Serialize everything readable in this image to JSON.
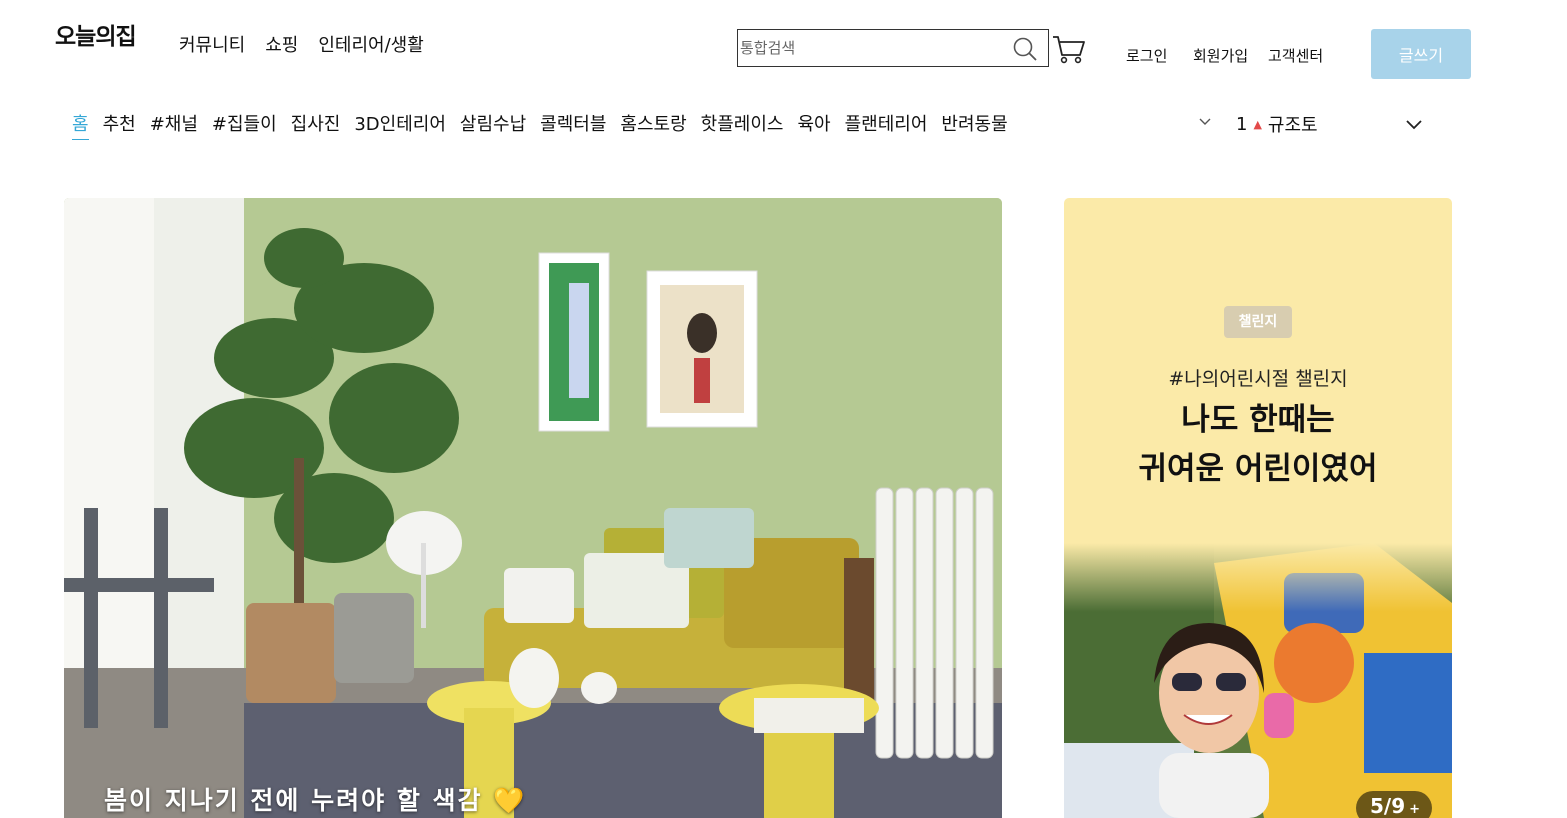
{
  "header": {
    "logo": "오늘의집",
    "nav": [
      "커뮤니티",
      "쇼핑",
      "인테리어/생활"
    ],
    "search_placeholder": "통합검색",
    "login": "로그인",
    "signup": "회원가입",
    "support": "고객센터",
    "write_button": "글쓰기",
    "write_button_color": "#a8d3ea"
  },
  "category_tabs": {
    "items": [
      "홈",
      "추천",
      "#채널",
      "#집들이",
      "집사진",
      "3D인테리어",
      "살림수납",
      "콜렉터블",
      "홈스토랑",
      "핫플레이스",
      "육아",
      "플랜테리어",
      "반려동물"
    ],
    "active_index": 0,
    "active_color": "#35a7d6"
  },
  "trending": {
    "rank": "1",
    "direction_symbol": "▲",
    "keyword": "규조토"
  },
  "hero": {
    "caption": "봄이 지나기 전에 누려야 할 색감",
    "caption_emoji": "💛"
  },
  "banner": {
    "badge": "챌린지",
    "subtitle": "#나의어린시절 챌린지",
    "title_line1": "나도 한때는",
    "title_line2": "귀여운 어린이였어",
    "pager": "5/9",
    "pager_more": "+",
    "background_color": "#fbeaa8"
  },
  "icons": {
    "search": "search-icon",
    "cart": "cart-icon",
    "category_more": "chevron-down-icon",
    "trending_more": "chevron-down-icon"
  }
}
